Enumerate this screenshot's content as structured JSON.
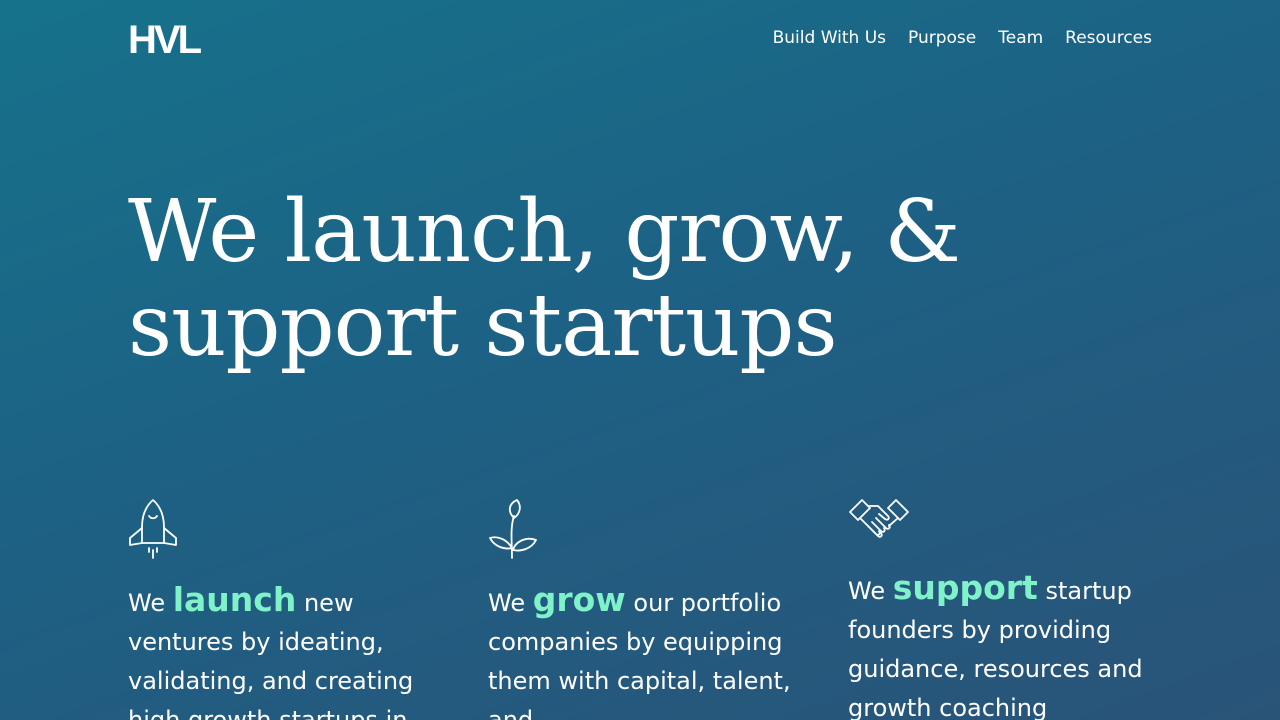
{
  "brand": {
    "logo_text": "HVL"
  },
  "nav": {
    "items": [
      {
        "label": "Build With Us"
      },
      {
        "label": "Purpose"
      },
      {
        "label": "Team"
      },
      {
        "label": "Resources"
      }
    ]
  },
  "hero": {
    "line1": "We launch, grow, &",
    "line2": "support startups"
  },
  "columns": [
    {
      "icon": "rocket-icon",
      "prefix": "We ",
      "accent": "launch",
      "text": " new ventures by ideating, validating, and creating high growth startups in"
    },
    {
      "icon": "sprout-icon",
      "prefix": "We ",
      "accent": "grow",
      "text": " our portfolio companies by equipping them with capital, talent, and"
    },
    {
      "icon": "handshake-icon",
      "prefix": "We ",
      "accent": "support",
      "text": " startup founders by providing guidance, resources and growth coaching"
    }
  ],
  "colors": {
    "background_start": "#16728b",
    "background_end": "#2a5378",
    "accent": "#7ff2c9",
    "text": "#ffffff"
  }
}
